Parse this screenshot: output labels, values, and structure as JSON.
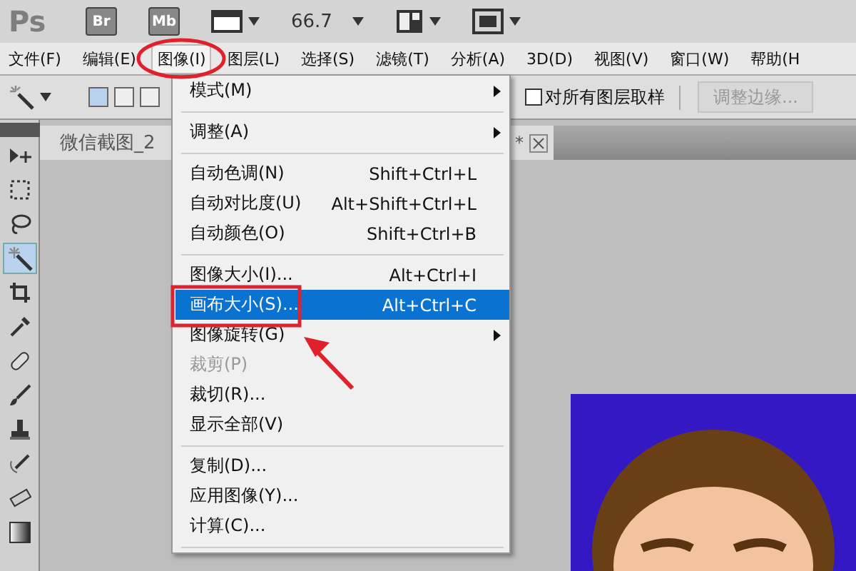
{
  "app_bar": {
    "logo": "Ps",
    "buttons": [
      {
        "kind": "text",
        "label": "Br"
      },
      {
        "kind": "text",
        "label": "Mb"
      },
      {
        "kind": "film"
      },
      {
        "kind": "zoom",
        "label": "66.7"
      },
      {
        "kind": "layout"
      },
      {
        "kind": "screen"
      }
    ]
  },
  "menu_bar": [
    {
      "label": "文件(F)",
      "selected": false
    },
    {
      "label": "编辑(E)",
      "selected": false
    },
    {
      "label": "图像(I)",
      "selected": true
    },
    {
      "label": "图层(L)",
      "selected": false
    },
    {
      "label": "选择(S)",
      "selected": false
    },
    {
      "label": "滤镜(T)",
      "selected": false
    },
    {
      "label": "分析(A)",
      "selected": false
    },
    {
      "label": "3D(D)",
      "selected": false
    },
    {
      "label": "视图(V)",
      "selected": false
    },
    {
      "label": "窗口(W)",
      "selected": false
    },
    {
      "label": "帮助(H",
      "selected": false
    }
  ],
  "options_bar": {
    "selection_modes": [
      {
        "selected": true
      },
      {
        "selected": false
      },
      {
        "selected": false
      }
    ],
    "sample_all_layers": {
      "label": "对所有图层取样",
      "checked": false
    },
    "refine_edge": {
      "label": "调整边缘...",
      "disabled": true
    }
  },
  "tools": [
    {
      "kind": "move",
      "selected": false
    },
    {
      "kind": "marquee",
      "selected": false
    },
    {
      "kind": "lasso",
      "selected": false
    },
    {
      "kind": "wand",
      "selected": true
    },
    {
      "kind": "crop",
      "selected": false
    },
    {
      "kind": "eyedropper",
      "selected": false
    },
    {
      "kind": "healing",
      "selected": false
    },
    {
      "kind": "brush",
      "selected": false
    },
    {
      "kind": "stamp",
      "selected": false
    },
    {
      "kind": "history",
      "selected": false
    },
    {
      "kind": "eraser",
      "selected": false
    },
    {
      "kind": "gradient",
      "selected": false
    }
  ],
  "document_tab": {
    "title": "微信截图_2",
    "modified_mark": "*"
  },
  "image_menu": [
    {
      "kind": "item",
      "label": "模式(M)",
      "submenu": true,
      "disabled": false,
      "selected": false
    },
    {
      "kind": "separator"
    },
    {
      "kind": "item",
      "label": "调整(A)",
      "submenu": true,
      "disabled": false,
      "selected": false
    },
    {
      "kind": "separator"
    },
    {
      "kind": "item",
      "label": "自动色调(N)",
      "shortcut": "Shift+Ctrl+L",
      "submenu": false,
      "disabled": false,
      "selected": false
    },
    {
      "kind": "item",
      "label": "自动对比度(U)",
      "shortcut": "Alt+Shift+Ctrl+L",
      "submenu": false,
      "disabled": false,
      "selected": false
    },
    {
      "kind": "item",
      "label": "自动颜色(O)",
      "shortcut": "Shift+Ctrl+B",
      "submenu": false,
      "disabled": false,
      "selected": false
    },
    {
      "kind": "separator"
    },
    {
      "kind": "item",
      "label": "图像大小(I)...",
      "shortcut": "Alt+Ctrl+I",
      "submenu": false,
      "disabled": false,
      "selected": false
    },
    {
      "kind": "item",
      "label": "画布大小(S)...",
      "shortcut": "Alt+Ctrl+C",
      "submenu": false,
      "disabled": false,
      "selected": true
    },
    {
      "kind": "item",
      "label": "图像旋转(G)",
      "submenu": true,
      "disabled": false,
      "selected": false
    },
    {
      "kind": "item",
      "label": "裁剪(P)",
      "submenu": false,
      "disabled": true,
      "selected": false
    },
    {
      "kind": "item",
      "label": "裁切(R)...",
      "submenu": false,
      "disabled": false,
      "selected": false
    },
    {
      "kind": "item",
      "label": "显示全部(V)",
      "submenu": false,
      "disabled": false,
      "selected": false
    },
    {
      "kind": "separator"
    },
    {
      "kind": "item",
      "label": "复制(D)...",
      "submenu": false,
      "disabled": false,
      "selected": false
    },
    {
      "kind": "item",
      "label": "应用图像(Y)...",
      "submenu": false,
      "disabled": false,
      "selected": false
    },
    {
      "kind": "item",
      "label": "计算(C)...",
      "submenu": false,
      "disabled": false,
      "selected": false
    },
    {
      "kind": "separator"
    }
  ]
}
